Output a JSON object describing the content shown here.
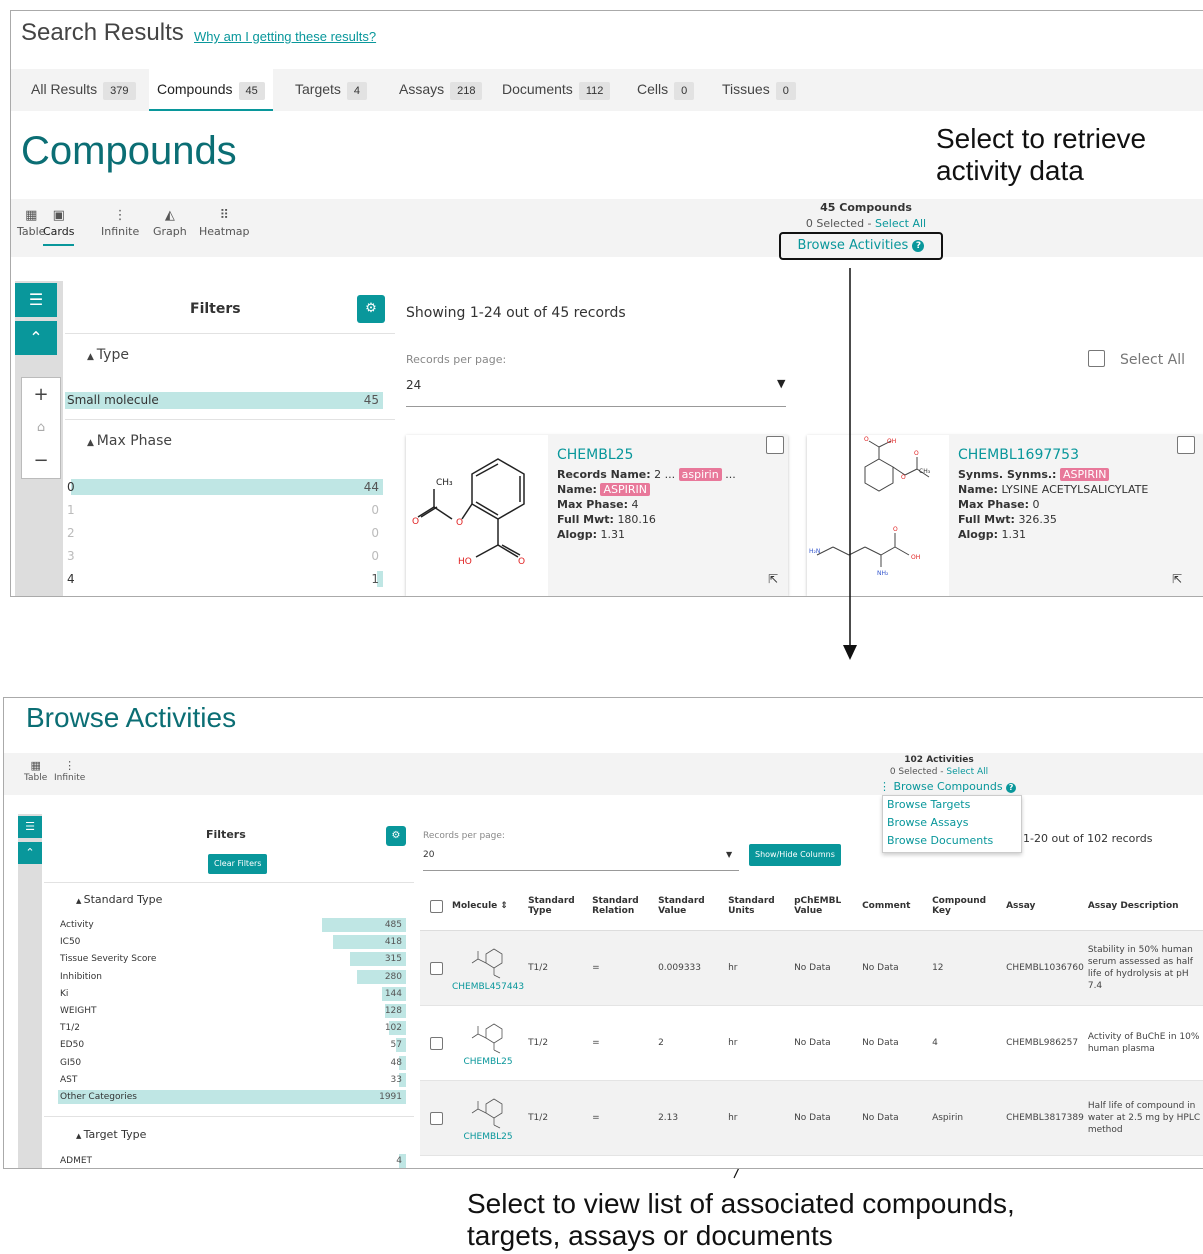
{
  "top": {
    "heading": "Search Results",
    "why_link": "Why am I getting these results?",
    "tabs": [
      {
        "label": "All Results",
        "count": "379"
      },
      {
        "label": "Compounds",
        "count": "45"
      },
      {
        "label": "Targets",
        "count": "4"
      },
      {
        "label": "Assays",
        "count": "218"
      },
      {
        "label": "Documents",
        "count": "112"
      },
      {
        "label": "Cells",
        "count": "0"
      },
      {
        "label": "Tissues",
        "count": "0"
      }
    ],
    "page_title": "Compounds",
    "views": [
      "Table",
      "Cards",
      "Infinite",
      "Graph",
      "Heatmap"
    ],
    "count_label": "45 Compounds",
    "selected": "0 Selected - ",
    "select_all_link": "Select All",
    "browse_activities": "Browse Activities",
    "filters_title": "Filters",
    "type_section": "Type",
    "type_rows": [
      {
        "label": "Small molecule",
        "value": "45",
        "fill": 1.0
      }
    ],
    "phase_section": "Max Phase",
    "phase_rows": [
      {
        "label": "0",
        "value": "44",
        "fill": 0.98
      },
      {
        "label": "1",
        "value": "0",
        "fill": 0
      },
      {
        "label": "2",
        "value": "0",
        "fill": 0
      },
      {
        "label": "3",
        "value": "0",
        "fill": 0
      },
      {
        "label": "4",
        "value": "1",
        "fill": 0.02
      }
    ],
    "showing": "Showing 1-24 out of 45 records",
    "records_per_page_label": "Records per page:",
    "records_per_page": "24",
    "select_all": "Select All",
    "cards": [
      {
        "id": "CHEMBL25",
        "l1k": "Records Name:",
        "l1v": "2 ...",
        "l1tag": "aspirin",
        "l1tail": "...",
        "l2k": "Name:",
        "l2tag": "ASPIRIN",
        "l3k": "Max Phase:",
        "l3v": "4",
        "l4k": "Full Mwt:",
        "l4v": "180.16",
        "l5k": "Alogp:",
        "l5v": "1.31"
      },
      {
        "id": "CHEMBL1697753",
        "l1k": "Synms. Synms.:",
        "l1tag": "ASPIRIN",
        "l2k": "Name:",
        "l2v": "LYSINE ACETYLSALICYLATE",
        "l3k": "Max Phase:",
        "l3v": "0",
        "l4k": "Full Mwt:",
        "l4v": "326.35",
        "l5k": "Alogp:",
        "l5v": "1.31"
      }
    ]
  },
  "annotations": {
    "top_right": [
      "Select to retrieve",
      "activity data"
    ],
    "bottom": [
      "Select to view list of associated compounds,",
      "targets, assays or documents"
    ]
  },
  "bottom": {
    "title": "Browse Activities",
    "views": [
      "Table",
      "Infinite"
    ],
    "count_label": "102 Activities",
    "selected": "0 Selected - ",
    "select_all_link": "Select All",
    "browse_compounds": "Browse Compounds",
    "menu": [
      "Browse Targets",
      "Browse Assays",
      "Browse Documents"
    ],
    "filters_title": "Filters",
    "clear_filters": "Clear Filters",
    "standard_type_section": "Standard Type",
    "standard_type_rows": [
      {
        "label": "Activity",
        "value": "485",
        "fill": 0.24
      },
      {
        "label": "IC50",
        "value": "418",
        "fill": 0.21
      },
      {
        "label": "Tissue Severity Score",
        "value": "315",
        "fill": 0.16
      },
      {
        "label": "Inhibition",
        "value": "280",
        "fill": 0.14
      },
      {
        "label": "Ki",
        "value": "144",
        "fill": 0.07
      },
      {
        "label": "WEIGHT",
        "value": "128",
        "fill": 0.06
      },
      {
        "label": "T1/2",
        "value": "102",
        "fill": 0.05
      },
      {
        "label": "ED50",
        "value": "57",
        "fill": 0.03
      },
      {
        "label": "GI50",
        "value": "48",
        "fill": 0.02
      },
      {
        "label": "AST",
        "value": "33",
        "fill": 0.02
      },
      {
        "label": "Other Categories",
        "value": "1991",
        "fill": 1.0
      }
    ],
    "target_type_section": "Target Type",
    "target_type_rows": [
      {
        "label": "ADMET",
        "value": "4",
        "fill": 0.02
      }
    ],
    "records_per_page_label": "Records per page:",
    "records_per_page": "20",
    "show_hide": "Show/Hide Columns",
    "range": "1-20 out of 102 records",
    "columns": [
      "Molecule",
      "Standard Type",
      "Standard Relation",
      "Standard Value",
      "Standard Units",
      "pChEMBL Value",
      "Comment",
      "Compound Key",
      "Assay",
      "Assay Description"
    ],
    "rows": [
      {
        "molecule": "CHEMBL457443",
        "type": "T1/2",
        "relation": "=",
        "value": "0.009333",
        "units": "hr",
        "pchembl": "No Data",
        "comment": "No Data",
        "key": "12",
        "assay": "CHEMBL1036760",
        "desc": "Stability in 50% human serum assessed as half life of hydrolysis at pH 7.4"
      },
      {
        "molecule": "CHEMBL25",
        "type": "T1/2",
        "relation": "=",
        "value": "2",
        "units": "hr",
        "pchembl": "No Data",
        "comment": "No Data",
        "key": "4",
        "assay": "CHEMBL986257",
        "desc": "Activity of BuChE in 10% human plasma"
      },
      {
        "molecule": "CHEMBL25",
        "type": "T1/2",
        "relation": "=",
        "value": "2.13",
        "units": "hr",
        "pchembl": "No Data",
        "comment": "No Data",
        "key": "Aspirin",
        "assay": "CHEMBL3817389",
        "desc": "Half life of compound in water at 2.5 mg by HPLC method"
      }
    ]
  },
  "icons": [
    "table-icon",
    "cards-icon",
    "infinite-icon",
    "graph-icon",
    "heatmap-icon",
    "sliders-icon",
    "chevron-up-icon",
    "gear-icon",
    "zoom-in-icon",
    "home-icon",
    "zoom-out-icon",
    "checkbox-icon",
    "external-link-icon",
    "help-icon",
    "caret-down-icon",
    "sort-icon"
  ],
  "colors": {
    "accent": "#09979b",
    "title": "#0b6e74",
    "tag": "#e8789a",
    "bar": "#bfe6e4"
  }
}
